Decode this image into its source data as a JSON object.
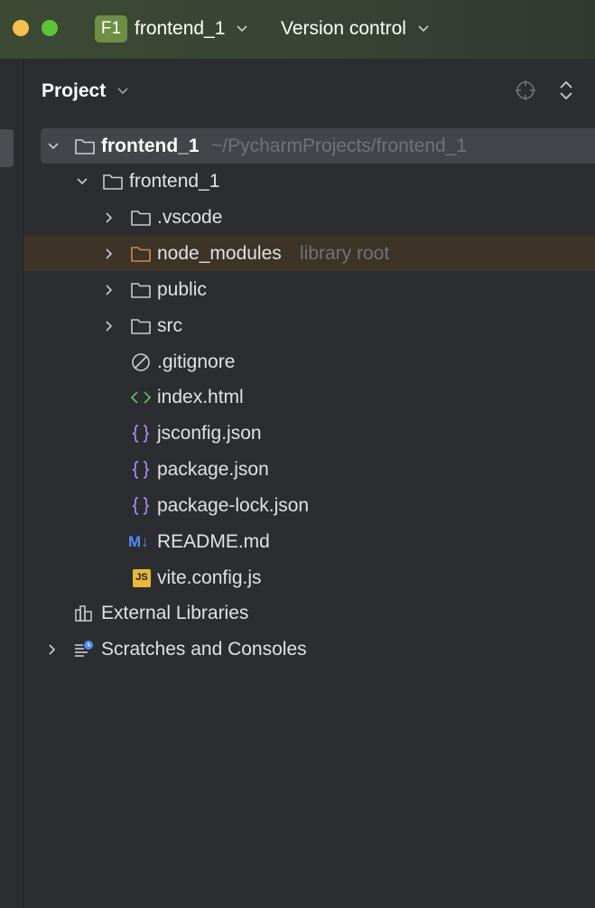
{
  "titlebar": {
    "project_badge": "F1",
    "project_name": "frontend_1",
    "version_control": "Version control"
  },
  "panel": {
    "title": "Project"
  },
  "tree": {
    "root": {
      "label": "frontend_1",
      "path_hint": "~/PycharmProjects/frontend_1"
    },
    "module": {
      "label": "frontend_1"
    },
    "vscode": {
      "label": ".vscode"
    },
    "node_modules": {
      "label": "node_modules",
      "hint": "library root"
    },
    "public": {
      "label": "public"
    },
    "src": {
      "label": "src"
    },
    "gitignore": {
      "label": ".gitignore"
    },
    "index_html": {
      "label": "index.html"
    },
    "jsconfig": {
      "label": "jsconfig.json"
    },
    "package": {
      "label": "package.json"
    },
    "package_lock": {
      "label": "package-lock.json"
    },
    "readme": {
      "label": "README.md",
      "badge": "M↓"
    },
    "vite_config": {
      "label": "vite.config.js",
      "badge": "JS"
    },
    "external_libraries": {
      "label": "External Libraries"
    },
    "scratches": {
      "label": "Scratches and Consoles"
    }
  },
  "colors": {
    "panel_bg": "#2b2d30",
    "selected_row": "#43454a",
    "excluded_row": "#3d3326",
    "excluded_folder": "#d0885a",
    "json_icon": "#b189f5",
    "html_icon": "#5fb865",
    "md_badge": "#548af7",
    "js_badge": "#e8b73b"
  }
}
